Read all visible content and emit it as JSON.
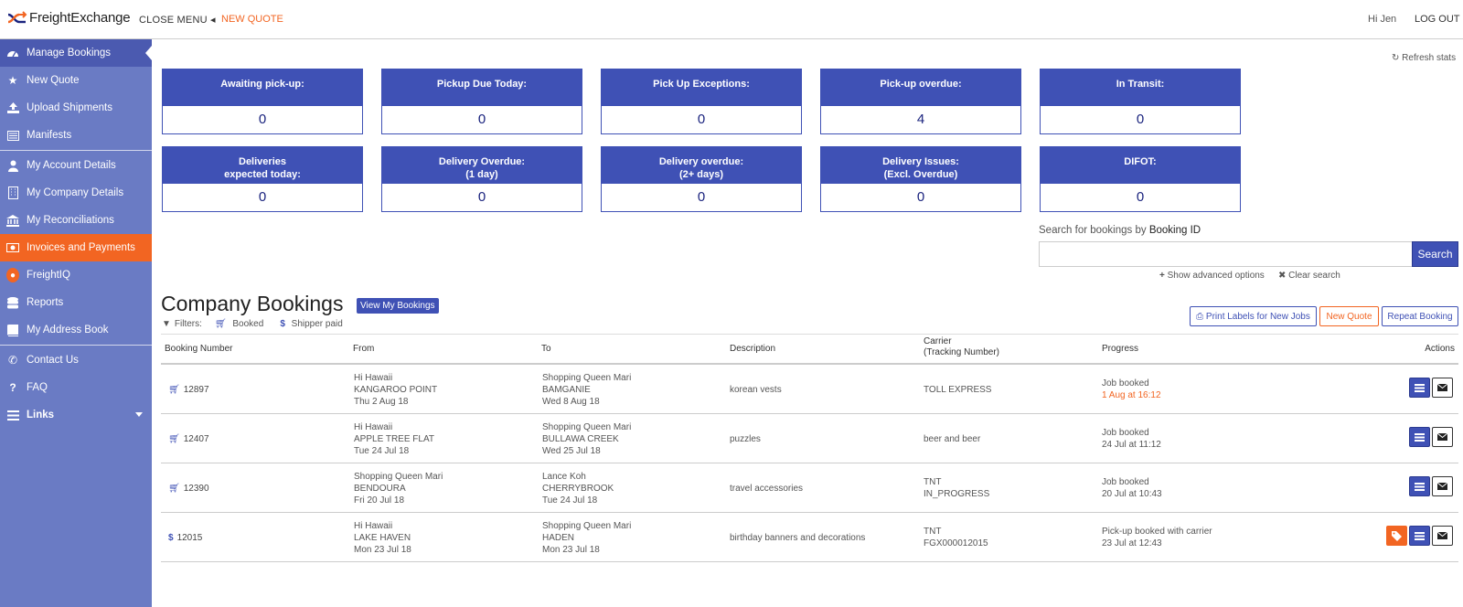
{
  "header": {
    "brand": "FreightExchange",
    "close_menu": "CLOSE MENU",
    "new_quote": "NEW QUOTE",
    "greeting": "Hi Jen",
    "logout": "LOG OUT"
  },
  "sidebar": {
    "items": [
      {
        "label": "Manage Bookings",
        "icon": "dashboard-icon"
      },
      {
        "label": "New Quote",
        "icon": "star-icon"
      },
      {
        "label": "Upload Shipments",
        "icon": "upload-icon"
      },
      {
        "label": "Manifests",
        "icon": "manifest-icon"
      },
      {
        "label": "My Account Details",
        "icon": "user-icon"
      },
      {
        "label": "My Company Details",
        "icon": "building-icon"
      },
      {
        "label": "My Reconciliations",
        "icon": "bank-icon"
      },
      {
        "label": "Invoices and Payments",
        "icon": "money-icon"
      },
      {
        "label": "FreightIQ",
        "icon": "lightbulb-icon"
      },
      {
        "label": "Reports",
        "icon": "database-icon"
      },
      {
        "label": "My Address Book",
        "icon": "book-icon"
      },
      {
        "label": "Contact Us",
        "icon": "phone-icon"
      },
      {
        "label": "FAQ",
        "icon": "question-icon"
      },
      {
        "label": "Links",
        "icon": "bars-icon"
      }
    ]
  },
  "stats": {
    "refresh_label": "Refresh stats",
    "cards": [
      {
        "label": "Awaiting pick-up:",
        "value": "0"
      },
      {
        "label": "Pickup Due Today:",
        "value": "0"
      },
      {
        "label": "Pick Up Exceptions:",
        "value": "0"
      },
      {
        "label": "Pick-up overdue:",
        "value": "4"
      },
      {
        "label": "In Transit:",
        "value": "0"
      },
      {
        "label": "Deliveries\nexpected today:",
        "value": "0"
      },
      {
        "label": "Delivery Overdue:\n(1 day)",
        "value": "0"
      },
      {
        "label": "Delivery overdue:\n(2+ days)",
        "value": "0"
      },
      {
        "label": "Delivery Issues:\n(Excl. Overdue)",
        "value": "0"
      },
      {
        "label": "DIFOT:",
        "value": "0"
      }
    ]
  },
  "search": {
    "label_prefix": "Search for bookings by",
    "label_bold": "Booking ID",
    "value": "",
    "placeholder": "",
    "button": "Search",
    "advanced": "Show advanced options",
    "clear": "Clear search"
  },
  "bookings": {
    "title": "Company Bookings",
    "view_my": "View My Bookings",
    "filters_label": "Filters:",
    "filter_booked": "Booked",
    "filter_shipper": "Shipper paid",
    "print_labels": "Print Labels for New Jobs",
    "new_quote": "New Quote",
    "repeat": "Repeat Booking",
    "columns": {
      "number": "Booking Number",
      "from": "From",
      "to": "To",
      "description": "Description",
      "carrier": "Carrier",
      "carrier_sub": "(Tracking Number)",
      "progress": "Progress",
      "actions": "Actions"
    },
    "rows": [
      {
        "number": "12897",
        "type": "cart",
        "from_name": "Hi Hawaii",
        "from_place": "KANGAROO POINT",
        "from_date": "Thu 2 Aug 18",
        "to_name": "Shopping Queen Mari",
        "to_place": "BAMGANIE",
        "to_date": "Wed 8 Aug 18",
        "description": "korean vests",
        "carrier": "TOLL EXPRESS",
        "tracking": "",
        "progress": "Job booked",
        "progress_date": "1 Aug at 16:12"
      },
      {
        "number": "12407",
        "type": "cart",
        "from_name": "Hi Hawaii",
        "from_place": "APPLE TREE FLAT",
        "from_date": "Tue 24 Jul 18",
        "to_name": "Shopping Queen Mari",
        "to_place": "BULLAWA CREEK",
        "to_date": "Wed 25 Jul 18",
        "description": "puzzles",
        "carrier": "beer and beer",
        "tracking": "",
        "progress": "Job booked",
        "progress_date": "24 Jul at 11:12"
      },
      {
        "number": "12390",
        "type": "cart",
        "from_name": "Shopping Queen Mari",
        "from_place": "BENDOURA",
        "from_date": "Fri 20 Jul 18",
        "to_name": "Lance Koh",
        "to_place": "CHERRYBROOK",
        "to_date": "Tue 24 Jul 18",
        "description": "travel accessories",
        "carrier": "TNT",
        "tracking": "IN_PROGRESS",
        "progress": "Job booked",
        "progress_date": "20 Jul at 10:43"
      },
      {
        "number": "12015",
        "type": "dollar",
        "from_name": "Hi Hawaii",
        "from_place": "LAKE HAVEN",
        "from_date": "Mon 23 Jul 18",
        "to_name": "Shopping Queen Mari",
        "to_place": "HADEN",
        "to_date": "Mon 23 Jul 18",
        "description": "birthday banners and decorations",
        "carrier": "TNT",
        "tracking": "FGX000012015",
        "progress": "Pick-up booked with carrier",
        "progress_date": "23 Jul at 12:43"
      }
    ]
  },
  "colors": {
    "brand_blue": "#3f51b5",
    "sidebar": "#6a7bc4",
    "accent_orange": "#f26522"
  }
}
